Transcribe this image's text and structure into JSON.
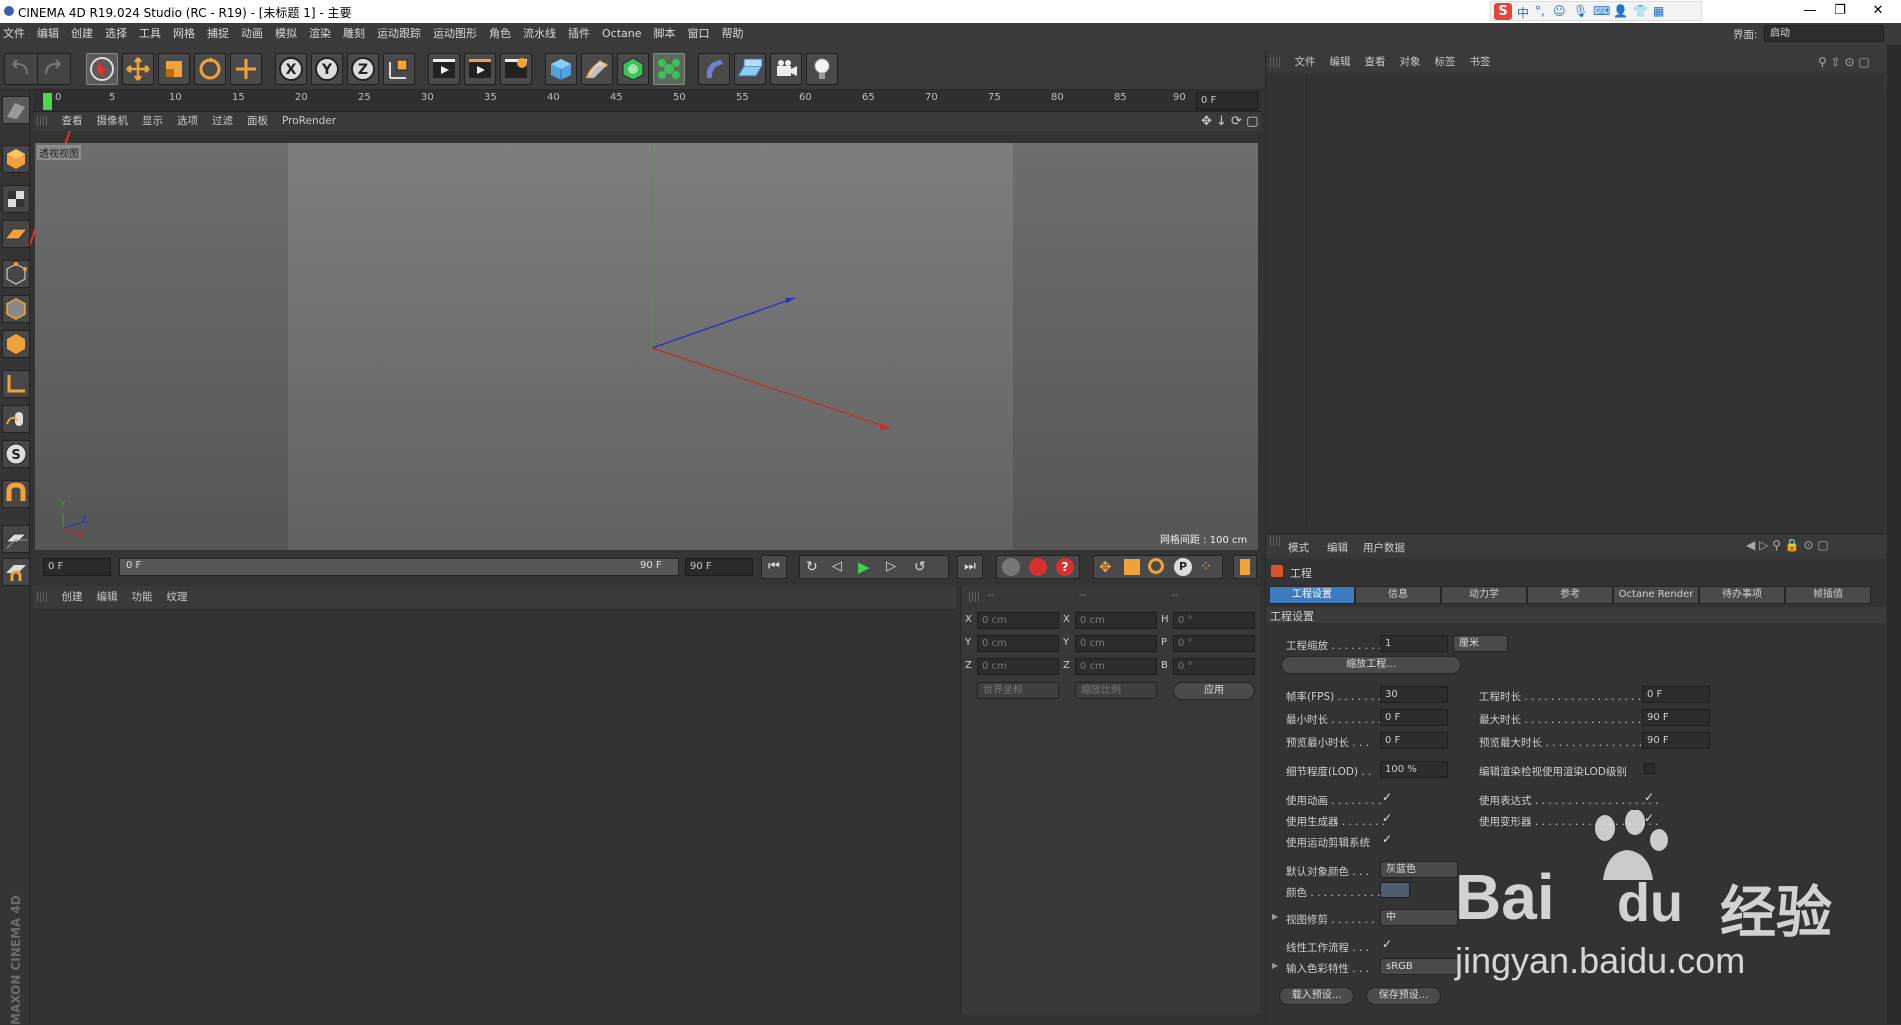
{
  "window": {
    "title": "CINEMA 4D R19.024 Studio (RC - R19) - [未标题 1] - 主要"
  },
  "ime_toolbar": {
    "label": "中"
  },
  "menubar": {
    "items": [
      "文件",
      "编辑",
      "创建",
      "选择",
      "工具",
      "网格",
      "捕捉",
      "动画",
      "模拟",
      "渲染",
      "雕刻",
      "运动跟踪",
      "运动图形",
      "角色",
      "流水线",
      "插件",
      "Octane",
      "脚本",
      "窗口",
      "帮助"
    ],
    "layout_label": "界面:",
    "layout_value": "启动"
  },
  "timeline": {
    "ticks": [
      "0",
      "5",
      "10",
      "15",
      "20",
      "25",
      "30",
      "35",
      "40",
      "45",
      "50",
      "55",
      "60",
      "65",
      "70",
      "75",
      "80",
      "85",
      "90"
    ],
    "current_frame": "0 F"
  },
  "viewport": {
    "menu": [
      "查看",
      "摄像机",
      "显示",
      "选项",
      "过滤",
      "面板",
      "ProRender"
    ],
    "name": "透视视图",
    "grid_spacing": "网格间距 : 100 cm",
    "axis_y": "Y",
    "axis_z": "Z",
    "axis_x": "X"
  },
  "anim": {
    "start": "0 F",
    "slider_left": "0 F",
    "slider_right": "90 F",
    "end": "90 F"
  },
  "materials": {
    "menu": [
      "创建",
      "编辑",
      "功能",
      "纹理"
    ]
  },
  "coords": {
    "headers": [
      "--",
      "--",
      "--"
    ],
    "rows": [
      {
        "a": "X",
        "av": "0 cm",
        "b": "X",
        "bv": "0 cm",
        "c": "H",
        "cv": "0 °"
      },
      {
        "a": "Y",
        "av": "0 cm",
        "b": "Y",
        "bv": "0 cm",
        "c": "P",
        "cv": "0 °"
      },
      {
        "a": "Z",
        "av": "0 cm",
        "b": "Z",
        "bv": "0 cm",
        "c": "B",
        "cv": "0 °"
      }
    ],
    "world": "世界坐标",
    "scale": "缩放比例",
    "apply": "应用"
  },
  "objmgr": {
    "menu": [
      "文件",
      "编辑",
      "查看",
      "对象",
      "标签",
      "书签"
    ]
  },
  "attr": {
    "menu": [
      "模式",
      "编辑",
      "用户数据"
    ],
    "title": "工程",
    "tabs": [
      "工程设置",
      "信息",
      "动力学",
      "参考",
      "Octane Render",
      "待办事项",
      "帧插值"
    ],
    "section": "工程设置",
    "project_scale_label": "工程缩放 . . . . . . . . .",
    "project_scale_value": "1",
    "project_scale_unit": "厘米",
    "scale_project_btn": "缩放工程...",
    "fps_label": "帧率(FPS) . . . . . . .",
    "fps_value": "30",
    "project_time_label": "工程时长 . . . . . . . . . . . . . . . . . . . .",
    "project_time_value": "0 F",
    "min_time_label": "最小时长 . . . . . . . . .",
    "min_time_value": "0 F",
    "max_time_label": "最大时长 . . . . . . . . . . . . . . . . . . . .",
    "max_time_value": "90 F",
    "preview_min_label": "预览最小时长 . . .",
    "preview_min_value": "0 F",
    "preview_max_label": "预览最大时长 . . . . . . . . . . . . . . . .",
    "preview_max_value": "90 F",
    "lod_label": "细节程度(LOD) . .",
    "lod_value": "100 %",
    "render_lod_label": "编辑渲染检视使用渲染LOD级别",
    "use_anim_label": "使用动画 . . . . . . . .",
    "use_expr_label": "使用表达式 . . . . . . . . . . . . . . . . . . .",
    "use_gen_label": "使用生成器 . . . . . . .",
    "use_deform_label": "使用变形器 . . . . . . . . . . . . . . . . . . .",
    "use_motion_label": "使用运动剪辑系统",
    "default_color_label": "默认对象颜色 . . .",
    "default_color_value": "灰蓝色",
    "color_label": "颜色 . . . . . . . . . . .",
    "color_swatch": "#4f5d6e",
    "clipping_label": "视图修剪 . . . . . . .",
    "clipping_value": "中",
    "linear_label": "线性工作流程 . . .",
    "input_color_label": "输入色彩特性 . . .",
    "input_color_value": "sRGB",
    "load_preset": "载入预设...",
    "save_preset": "保存预设...",
    "check": "✓"
  },
  "left_brand": "MAXON CINEMA 4D",
  "watermark": {
    "brand": "Bai",
    "brand2": "du",
    "cn": "经验",
    "url": "jingyan.baidu.com"
  },
  "colors": {
    "accent": "#3f7bbf",
    "annotation_arrow": "#e8302a",
    "menu_highlight": "#e8c84a"
  }
}
